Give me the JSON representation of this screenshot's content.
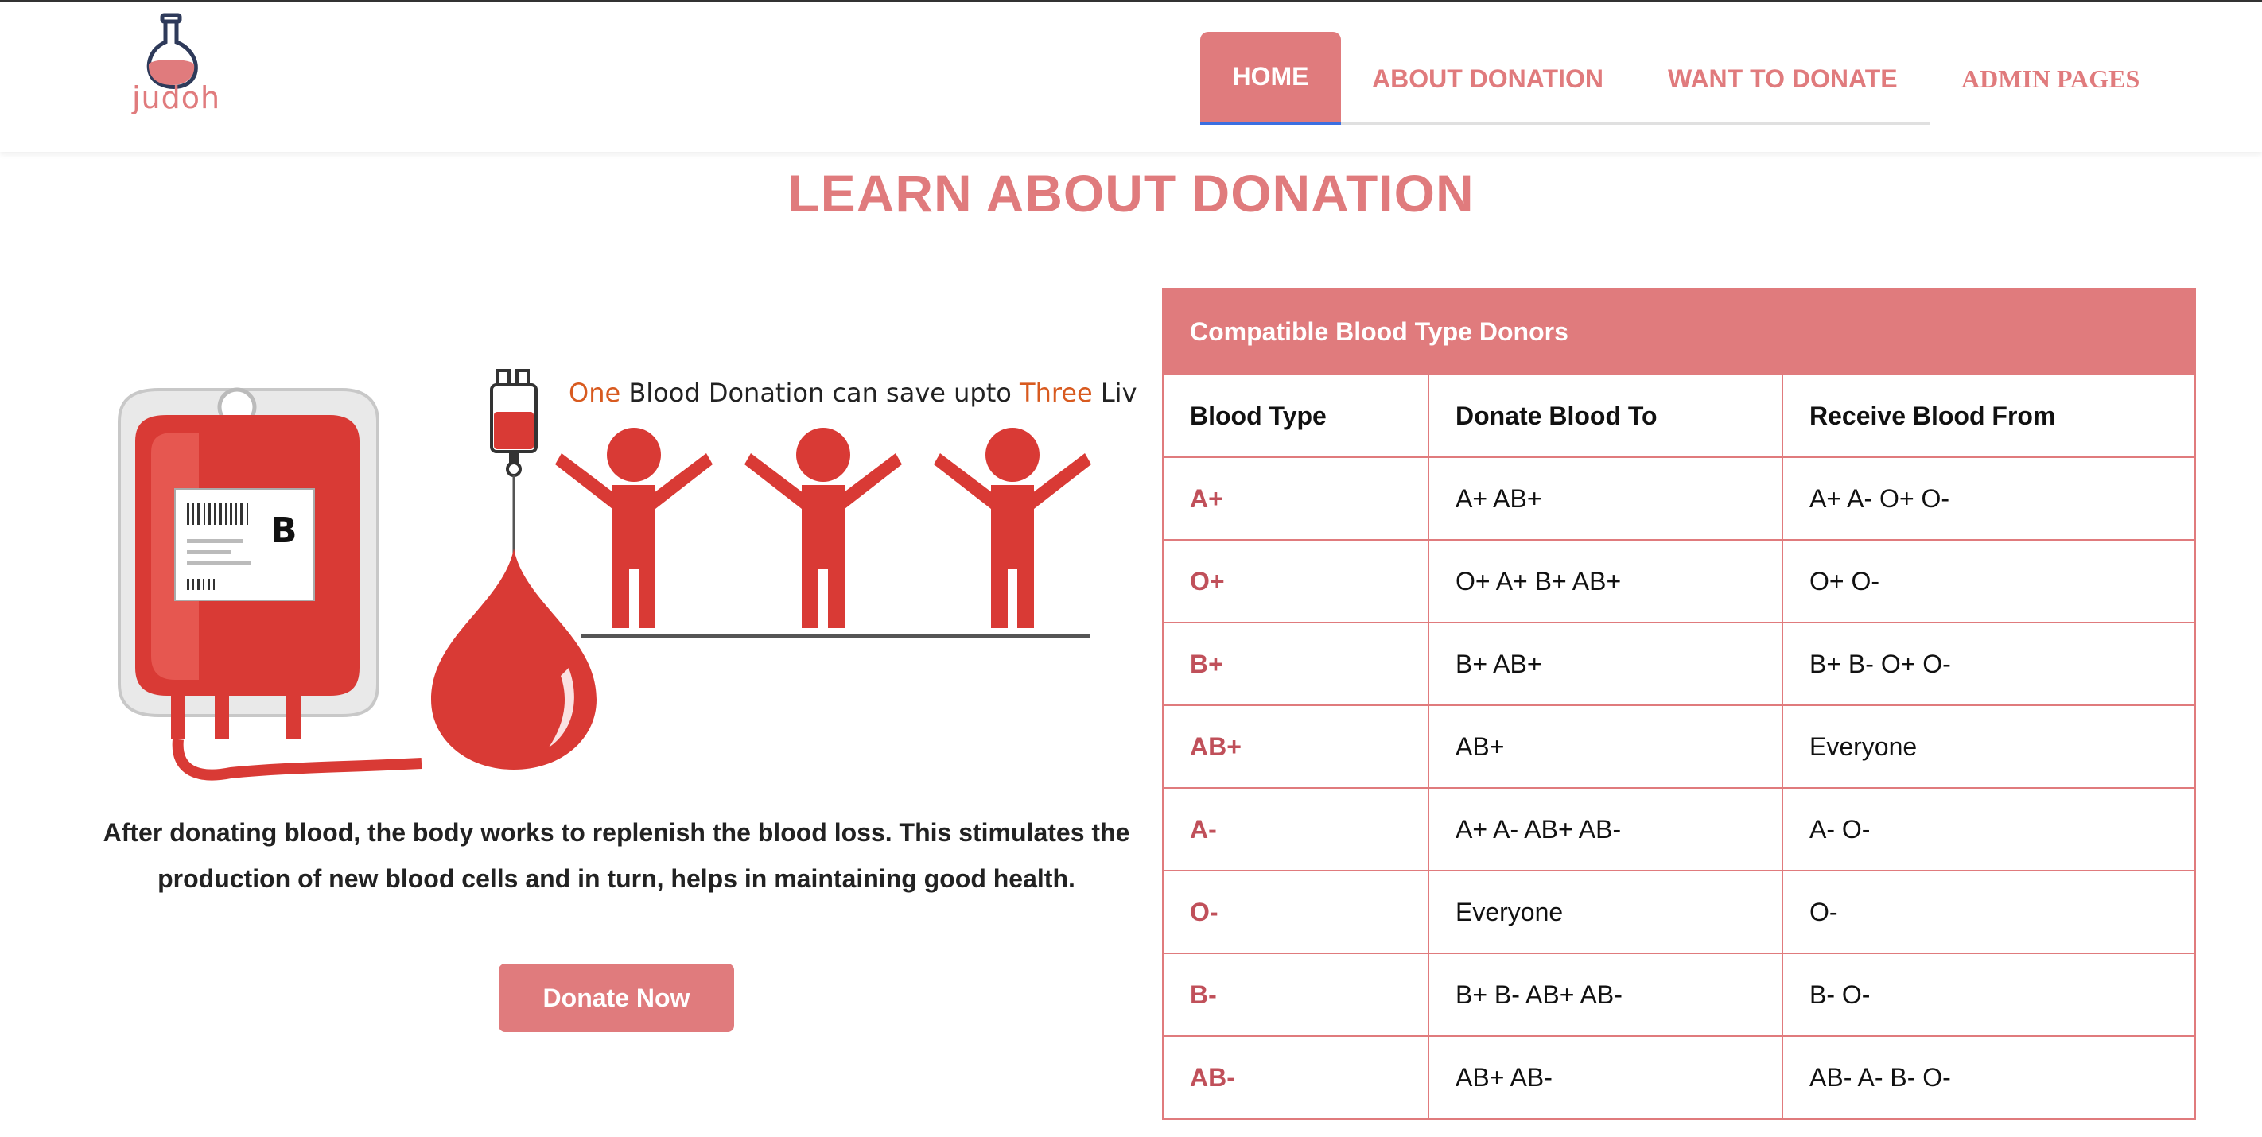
{
  "header": {
    "logo_text": "judoh",
    "nav": {
      "home": "HOME",
      "about": "ABOUT DONATION",
      "want": "WANT TO DONATE",
      "admin": "ADMIN PAGES"
    }
  },
  "main": {
    "title": "LEARN ABOUT DONATION",
    "illustration": {
      "bag_label": "B",
      "tagline_one": "One",
      "tagline_mid": " Blood Donation can save upto ",
      "tagline_three": "Three",
      "tagline_end": " Lives"
    },
    "paragraph_line1": "After donating blood, the body works to replenish the blood loss. This stimulates the",
    "paragraph_line2": "production of new blood cells and in turn, helps in maintaining good health.",
    "donate_button": "Donate Now"
  },
  "table": {
    "title": "Compatible Blood Type Donors",
    "headers": [
      "Blood Type",
      "Donate Blood To",
      "Receive Blood From"
    ],
    "rows": [
      [
        "A+",
        "A+ AB+",
        "A+ A- O+ O-"
      ],
      [
        "O+",
        "O+ A+ B+ AB+",
        "O+ O-"
      ],
      [
        "B+",
        "B+ AB+",
        "B+ B- O+ O-"
      ],
      [
        "AB+",
        "AB+",
        "Everyone"
      ],
      [
        "A-",
        "A+ A- AB+ AB-",
        "A- O-"
      ],
      [
        "O-",
        "Everyone",
        "O-"
      ],
      [
        "B-",
        "B+ B- AB+ AB-",
        "B- O-"
      ],
      [
        "AB-",
        "AB+ AB-",
        "AB- A- B- O-"
      ]
    ]
  },
  "colors": {
    "accent": "#e07b7d",
    "blood_red": "#d93a35",
    "blood_type_text": "#c0505a",
    "active_tab_underline": "#3b6fe0"
  },
  "icons": {
    "logo": "flask-icon",
    "illustration": "blood-bag-drop-people-illustration"
  }
}
